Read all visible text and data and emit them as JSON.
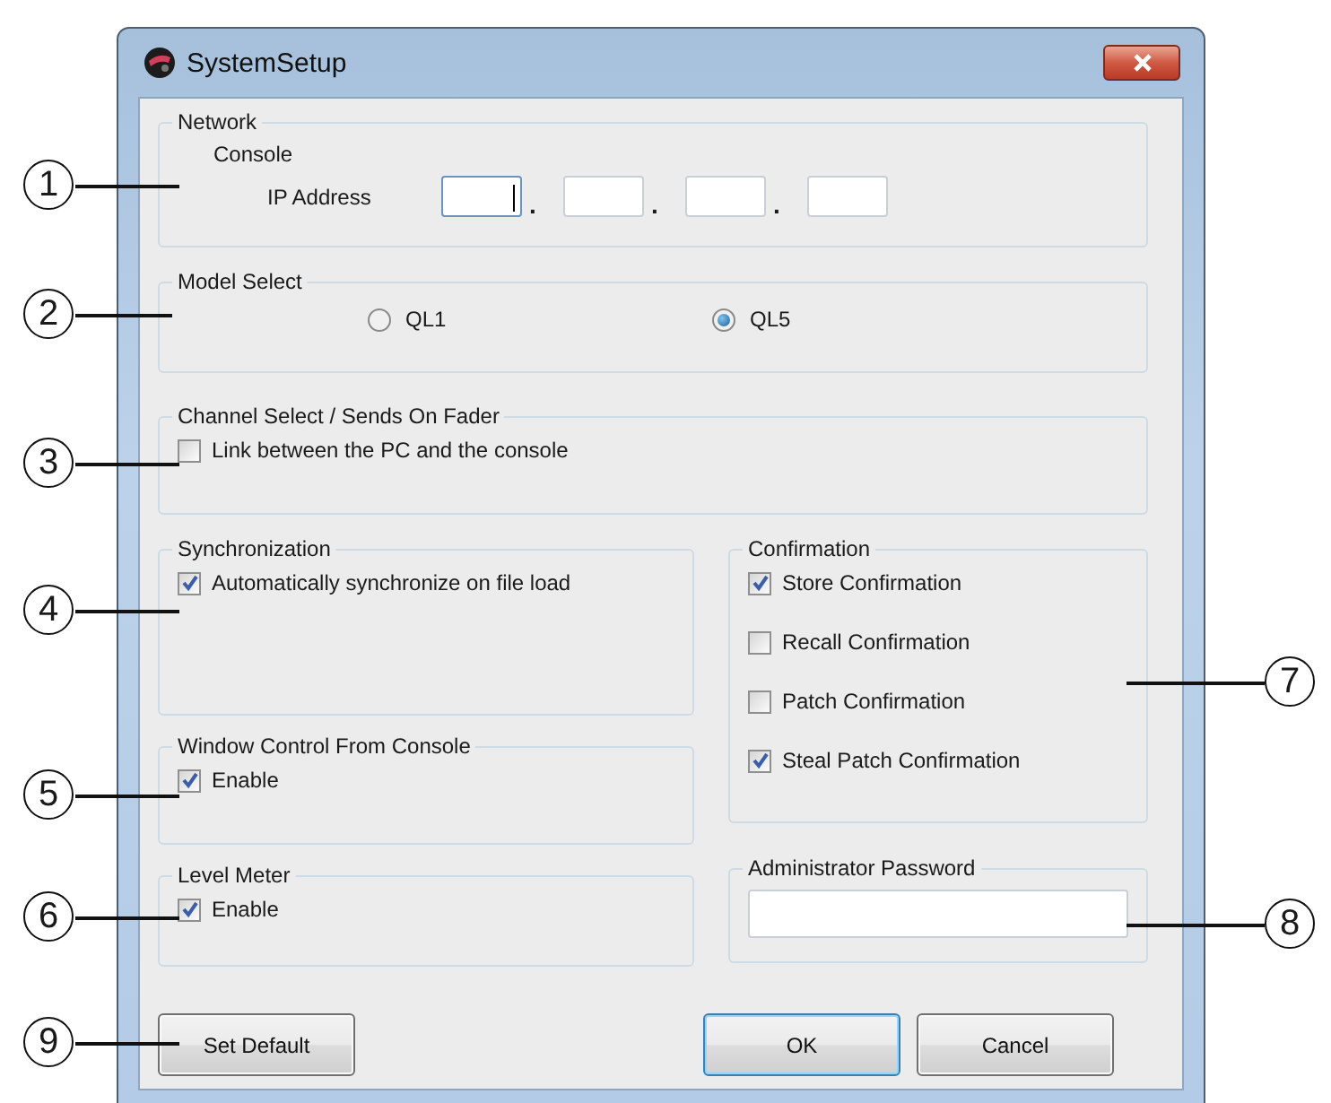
{
  "window": {
    "title": "SystemSetup"
  },
  "network": {
    "label": "Network",
    "console_label": "Console",
    "ip_label": "IP Address",
    "ip_fields": [
      {
        "focused": true
      },
      {
        "focused": false
      },
      {
        "focused": false
      },
      {
        "focused": false
      }
    ],
    "ip_separators": [
      ".",
      ".",
      "."
    ]
  },
  "model_select": {
    "label": "Model Select",
    "options": [
      {
        "label": "QL1",
        "selected": false
      },
      {
        "label": "QL5",
        "selected": true
      }
    ]
  },
  "channel_select": {
    "label": "Channel Select / Sends On Fader",
    "options": [
      {
        "label": "Link between the PC and the console",
        "checked": false
      }
    ]
  },
  "synchronization": {
    "label": "Synchronization",
    "options": [
      {
        "label": "Automatically synchronize on file load",
        "checked": true
      }
    ]
  },
  "window_control": {
    "label": "Window Control From Console",
    "options": [
      {
        "label": "Enable",
        "checked": true
      }
    ]
  },
  "level_meter": {
    "label": "Level Meter",
    "options": [
      {
        "label": "Enable",
        "checked": true
      }
    ]
  },
  "confirmation": {
    "label": "Confirmation",
    "options": [
      {
        "label": "Store Confirmation",
        "checked": true
      },
      {
        "label": "Recall Confirmation",
        "checked": false
      },
      {
        "label": "Patch Confirmation",
        "checked": false
      },
      {
        "label": "Steal Patch Confirmation",
        "checked": true
      }
    ]
  },
  "admin_password": {
    "label": "Administrator Password"
  },
  "buttons": [
    {
      "label": "Set Default",
      "default": false
    },
    {
      "label": "OK",
      "default": true
    },
    {
      "label": "Cancel",
      "default": false
    }
  ],
  "callouts": [
    "1",
    "2",
    "3",
    "4",
    "7",
    "5",
    "6",
    "8",
    "9"
  ]
}
